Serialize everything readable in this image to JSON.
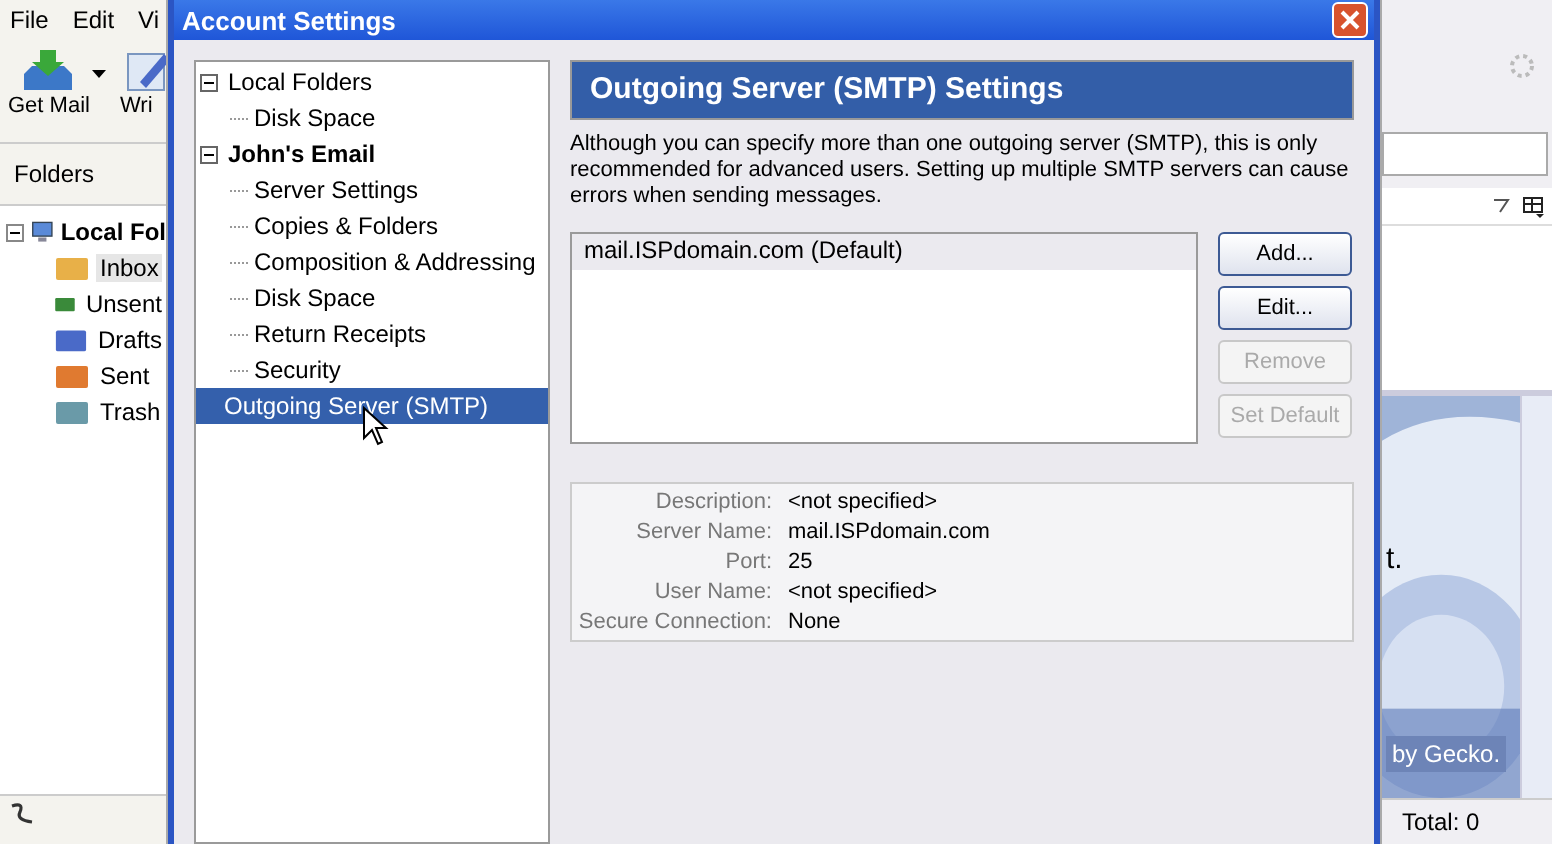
{
  "background_app": {
    "menu": [
      "File",
      "Edit",
      "Vi"
    ],
    "toolbar": [
      {
        "label": "Get Mail",
        "kind": "getmail",
        "has_dropdown": true
      },
      {
        "label": "Wri",
        "kind": "write"
      }
    ],
    "folders_header": "Folders",
    "folder_tree": {
      "label": "Local Fol",
      "expanded": true,
      "children": [
        {
          "label": "Inbox",
          "kind": "inbox",
          "selected": true
        },
        {
          "label": "Unsent",
          "kind": "unsent",
          "selected": false
        },
        {
          "label": "Drafts",
          "kind": "drafts",
          "selected": false
        },
        {
          "label": "Sent",
          "kind": "sent",
          "selected": false
        },
        {
          "label": "Trash",
          "kind": "trash",
          "selected": false
        }
      ]
    },
    "content_fragment": "t.",
    "banner_fragment": "by Gecko.",
    "status_total": "Total: 0"
  },
  "dialog": {
    "title": "Account Settings",
    "tree": [
      {
        "label": "Local Folders",
        "bold": false,
        "expandable": true,
        "expanded": true,
        "selected": false,
        "children": [
          {
            "label": "Disk Space",
            "selected": false
          }
        ]
      },
      {
        "label": "John's Email",
        "bold": true,
        "expandable": true,
        "expanded": true,
        "selected": false,
        "children": [
          {
            "label": "Server Settings",
            "selected": false
          },
          {
            "label": "Copies & Folders",
            "selected": false
          },
          {
            "label": "Composition & Addressing",
            "selected": false
          },
          {
            "label": "Disk Space",
            "selected": false
          },
          {
            "label": "Return Receipts",
            "selected": false
          },
          {
            "label": "Security",
            "selected": false
          }
        ]
      },
      {
        "label": "Outgoing Server (SMTP)",
        "bold": false,
        "expandable": false,
        "expanded": false,
        "selected": true
      }
    ],
    "panel": {
      "heading": "Outgoing Server (SMTP) Settings",
      "description": "Although you can specify more than one outgoing server (SMTP), this is only recommended for advanced users. Setting up multiple SMTP servers can cause errors when sending messages.",
      "servers": [
        {
          "label": "mail.ISPdomain.com (Default)",
          "selected": true
        }
      ],
      "buttons": [
        {
          "label": "Add...",
          "disabled": false
        },
        {
          "label": "Edit...",
          "disabled": false
        },
        {
          "label": "Remove",
          "disabled": true
        },
        {
          "label": "Set Default",
          "disabled": true
        }
      ],
      "details": [
        {
          "label": "Description:",
          "value": "<not specified>"
        },
        {
          "label": "Server Name:",
          "value": "mail.ISPdomain.com"
        },
        {
          "label": "Port:",
          "value": "25"
        },
        {
          "label": "User Name:",
          "value": "<not specified>"
        },
        {
          "label": "Secure Connection:",
          "value": "None"
        }
      ]
    }
  }
}
